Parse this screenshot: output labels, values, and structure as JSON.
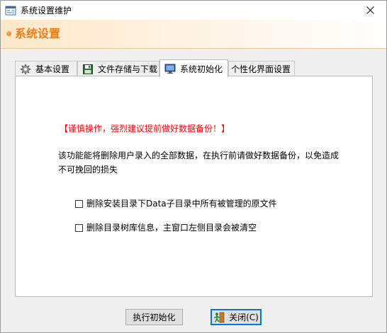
{
  "window": {
    "title": "系统设置维护",
    "icon": "window-settings-icon",
    "close_icon": "close-icon"
  },
  "banner": {
    "title": "系统设置",
    "accent_color": "#e87c1a"
  },
  "tabs": [
    {
      "label": "基本设置",
      "icon": "gear-icon",
      "active": false
    },
    {
      "label": "文件存储与下载",
      "icon": "floppy-disk-icon",
      "active": false
    },
    {
      "label": "系统初始化",
      "icon": "monitor-icon",
      "active": true
    },
    {
      "label": "个性化界面设置",
      "icon": "",
      "active": false
    }
  ],
  "panel": {
    "warning": "【谨慎操作，强烈建议提前做好数据备份！】",
    "warning_color": "#ff0000",
    "description": "该功能能将删除用户录入的全部数据，在执行前请做好数据备份，以免造成不可挽回的损失",
    "checkboxes": [
      {
        "label": "删除安装目录下Data子目录中所有被管理的原文件",
        "checked": false
      },
      {
        "label": "删除目录树库信息，主窗口左侧目录会被清空",
        "checked": false
      }
    ]
  },
  "buttons": {
    "init_label": "执行初始化",
    "close_label": "关闭(C)",
    "close_icon": "exit-person-icon"
  }
}
